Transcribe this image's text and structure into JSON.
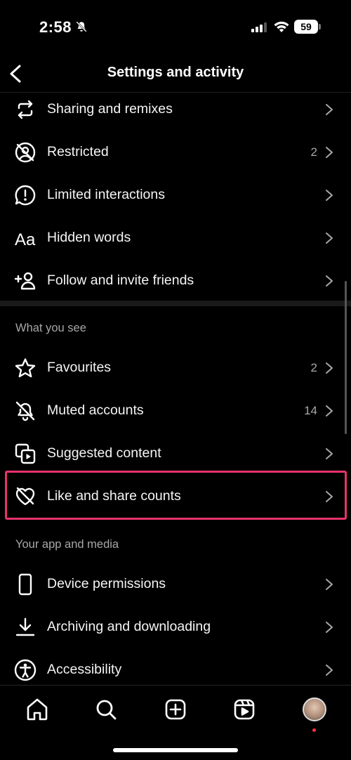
{
  "status_bar": {
    "time": "2:58",
    "battery": "59"
  },
  "header": {
    "title": "Settings and activity"
  },
  "group_interactions": {
    "items": [
      {
        "label": "Sharing and remixes",
        "icon": "sharing-remix-icon",
        "count": ""
      },
      {
        "label": "Restricted",
        "icon": "restricted-icon",
        "count": "2"
      },
      {
        "label": "Limited interactions",
        "icon": "limited-interactions-icon",
        "count": ""
      },
      {
        "label": "Hidden words",
        "icon": "hidden-words-icon",
        "count": ""
      },
      {
        "label": "Follow and invite friends",
        "icon": "follow-invite-icon",
        "count": ""
      }
    ]
  },
  "section_what_you_see": {
    "title": "What you see",
    "items": [
      {
        "label": "Favourites",
        "icon": "star-icon",
        "count": "2"
      },
      {
        "label": "Muted accounts",
        "icon": "muted-bell-icon",
        "count": "14"
      },
      {
        "label": "Suggested content",
        "icon": "suggested-content-icon",
        "count": ""
      },
      {
        "label": "Like and share counts",
        "icon": "heart-off-icon",
        "count": ""
      }
    ]
  },
  "section_app_media": {
    "title": "Your app and media",
    "items": [
      {
        "label": "Device permissions",
        "icon": "phone-icon",
        "count": ""
      },
      {
        "label": "Archiving and downloading",
        "icon": "download-icon",
        "count": ""
      },
      {
        "label": "Accessibility",
        "icon": "accessibility-icon",
        "count": ""
      }
    ]
  },
  "tab_bar": {
    "tabs": [
      "home-icon",
      "search-icon",
      "create-icon",
      "reels-icon",
      "profile-avatar"
    ]
  },
  "colors": {
    "background": "#000000",
    "highlight": "#e8336b",
    "secondary_text": "#a8a8a8"
  }
}
